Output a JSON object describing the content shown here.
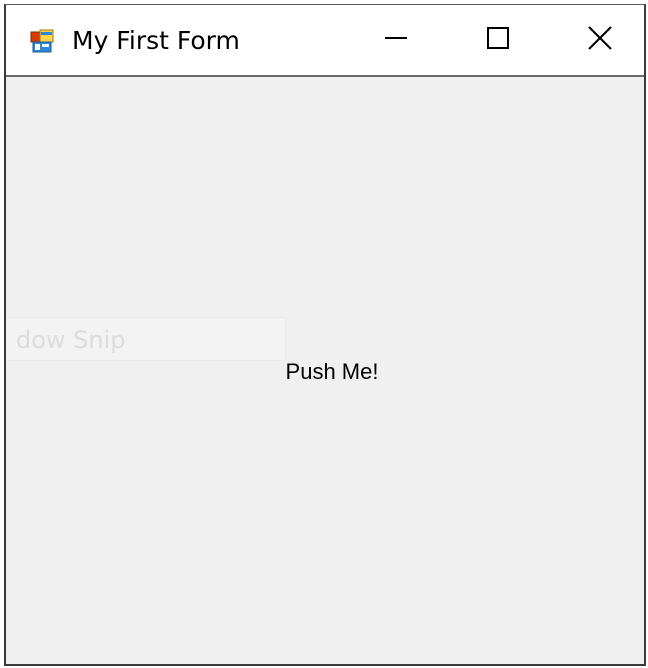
{
  "window": {
    "title": "My First Form",
    "app_icon": "winforms-app-icon",
    "caption_buttons": {
      "minimize_icon": "minimize-icon",
      "maximize_icon": "maximize-icon",
      "close_icon": "close-icon"
    }
  },
  "form": {
    "button_label": "Push Me!",
    "background_color": "#f0f0f0"
  },
  "overlay": {
    "ghost_text": "dow Snip"
  }
}
